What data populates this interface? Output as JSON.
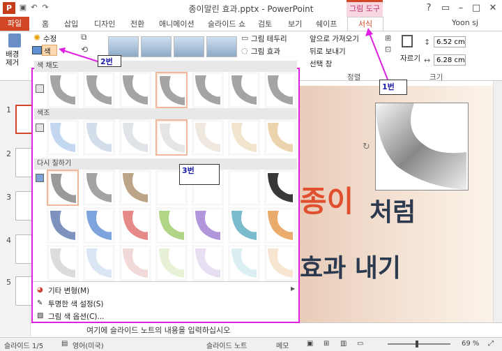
{
  "window": {
    "title": "종이말린 효과.pptx - PowerPoint",
    "context_tab_group": "그림 도구"
  },
  "tabs": [
    {
      "label": "파일"
    },
    {
      "label": "홈"
    },
    {
      "label": "삽입"
    },
    {
      "label": "디자인"
    },
    {
      "label": "전환"
    },
    {
      "label": "애니메이션"
    },
    {
      "label": "슬라이드 쇼"
    },
    {
      "label": "검토"
    },
    {
      "label": "보기"
    },
    {
      "label": "쉐이프"
    },
    {
      "label": "서식"
    }
  ],
  "user": "Yoon sj",
  "ribbon": {
    "remove_bg": "배경\n제거",
    "corrections": "수정",
    "color": "색",
    "picture_border": "그림 테두리",
    "picture_effects": "그림 효과",
    "bring_forward": "앞으로 가져오기",
    "send_backward": "뒤로 보내기",
    "selection_pane": "선택 창",
    "arrange_label": "정렬",
    "crop": "자르기",
    "height": "6.52 cm",
    "width": "6.28 cm",
    "size_label": "크기"
  },
  "gallery": {
    "sections": {
      "saturation": "색 채도",
      "tone": "색조",
      "recolor": "다시 칠하기"
    },
    "saturation_swatches": [
      "#9a9a9a",
      "#9a9a9a",
      "#9a9a9a",
      "#9a9a9a",
      "#9a9a9a",
      "#9a9a9a",
      "#9a9a9a"
    ],
    "tone_swatches": [
      "#bcd3ef",
      "#cfd9e8",
      "#dde0e6",
      "#e2e2e2",
      "#ece6dc",
      "#efe2c8",
      "#e9cfa4"
    ],
    "recolor_row1": [
      "#8f8f8f",
      "#999999",
      "#b59a7a",
      "#ffffff",
      "#ffffff",
      "#ffffff",
      "#222222"
    ],
    "recolor_row2": [
      "#6f86b8",
      "#6f9ad8",
      "#e37c7c",
      "#a9d07a",
      "#a98bd8",
      "#6cb4c8",
      "#e8a35c"
    ],
    "recolor_row3": [
      "#d8d8d8",
      "#d6e3f2",
      "#f1d5d5",
      "#e3efd2",
      "#e4dcef",
      "#d7ecf0",
      "#f6e2cc"
    ],
    "menu": [
      {
        "label": "기타 변형(M)",
        "icon": "palette-icon"
      },
      {
        "label": "투명한 색 설정(S)",
        "icon": "eyedropper-icon"
      },
      {
        "label": "그림 색 옵션(C)...",
        "icon": "picture-options-icon"
      }
    ]
  },
  "callouts": {
    "c1": "1번",
    "c2": "2번",
    "c3": "3번"
  },
  "slide": {
    "line1a": "종이",
    "line1b": "처럼",
    "line2": "효과 내기"
  },
  "thumbnails": [
    "1",
    "2",
    "3",
    "4",
    "5"
  ],
  "notes": {
    "placeholder": "여기에 슬라이드 노트의 내용을 입력하십시오"
  },
  "status": {
    "slide": "슬라이드 1/5",
    "lang": "영어(미국)",
    "notes_btn": "슬라이드 노트",
    "memo_btn": "메모",
    "zoom": "69 %"
  },
  "colors": {
    "accent": "#d24726",
    "highlight": "#e020e0"
  }
}
